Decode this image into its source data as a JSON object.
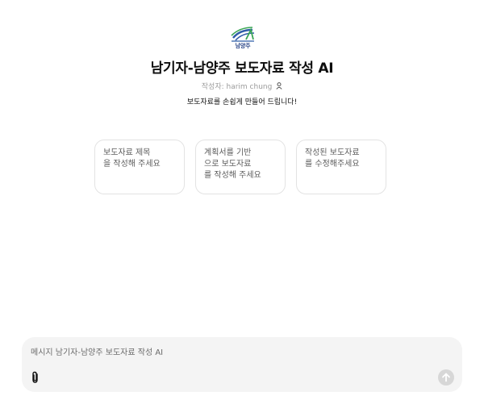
{
  "logo": {
    "text": "남양주",
    "icon": "namyangju-city-logo"
  },
  "header": {
    "title": "남기자-남양주 보도자료 작성 AI",
    "author": "작성자: harim chung",
    "author_icon": "person-icon",
    "subtitle": "보도자료를 손쉽게 만들어 드립니다!"
  },
  "suggestions": [
    {
      "label": "보도자료 제목\n을 작성해 주세요"
    },
    {
      "label": "계획서를 기반\n으로 보도자료\n를 작성해 주세요"
    },
    {
      "label": "작성된 보도자료\n를 수정해주세요"
    }
  ],
  "composer": {
    "placeholder": "메시지 남기자-남양주 보도자료 작성 AI",
    "value": "",
    "attach_icon": "paperclip-icon",
    "send_icon": "arrow-up-icon"
  },
  "colors": {
    "logo_blue": "#2f5da8",
    "logo_green": "#3aa655",
    "send_button_disabled": "#d7d7d7",
    "composer_background": "#f4f4f4"
  }
}
